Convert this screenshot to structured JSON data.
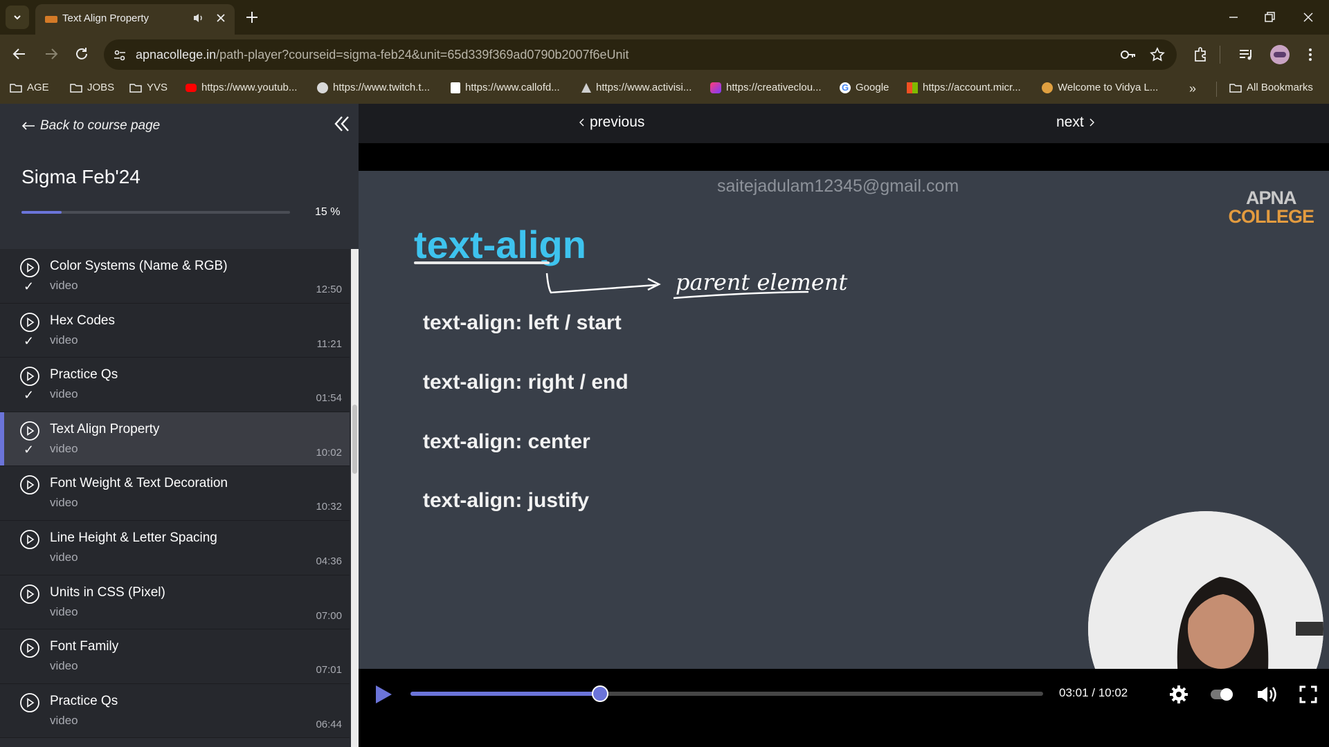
{
  "browser": {
    "tab_title": "Text Align Property",
    "url_host": "apnacollege.in",
    "url_rest": "/path-player?courseid=sigma-feb24&unit=65d339f369ad0790b2007f6eUnit",
    "bookmarks": [
      "AGE",
      "JOBS",
      "YVS",
      "https://www.youtub...",
      "https://www.twitch.t...",
      "https://www.callofd...",
      "https://www.activisi...",
      "https://creativeclou...",
      "Google",
      "https://account.micr...",
      "Welcome to Vidya L...",
      "All Bookmarks"
    ],
    "colors": {
      "tabstrip": "#2a2410",
      "toolbar": "#3e3620"
    }
  },
  "sidebar": {
    "back_label": "Back to course page",
    "course_title": "Sigma Feb'24",
    "progress": 15,
    "progress_label": "15 %",
    "lessons": [
      {
        "name": "Color Systems (Name & RGB)",
        "type": "video",
        "duration": "12:50",
        "done": true
      },
      {
        "name": "Hex Codes",
        "type": "video",
        "duration": "11:21",
        "done": true
      },
      {
        "name": "Practice Qs",
        "type": "video",
        "duration": "01:54",
        "done": true
      },
      {
        "name": "Text Align Property",
        "type": "video",
        "duration": "10:02",
        "done": true,
        "active": true
      },
      {
        "name": "Font Weight & Text Decoration",
        "type": "video",
        "duration": "10:32",
        "done": false
      },
      {
        "name": "Line Height & Letter Spacing",
        "type": "video",
        "duration": "04:36",
        "done": false
      },
      {
        "name": "Units in CSS (Pixel)",
        "type": "video",
        "duration": "07:00",
        "done": false
      },
      {
        "name": "Font Family",
        "type": "video",
        "duration": "07:01",
        "done": false
      },
      {
        "name": "Practice Qs",
        "type": "video",
        "duration": "06:44",
        "done": false
      }
    ],
    "accent": "#6b74d9"
  },
  "player": {
    "previous_label": "previous",
    "next_label": "next",
    "watermark": "saitejadulam12345@gmail.com",
    "logo_line1": "APNA",
    "logo_line2": "COLLEGE",
    "slide_title": "text-align",
    "handwriting": "parent element",
    "rules": [
      "text-align: left / start",
      "text-align: right / end",
      "text-align: center",
      "text-align: justify"
    ],
    "time_label": "03:01 / 10:02",
    "played_fraction": 0.3
  }
}
